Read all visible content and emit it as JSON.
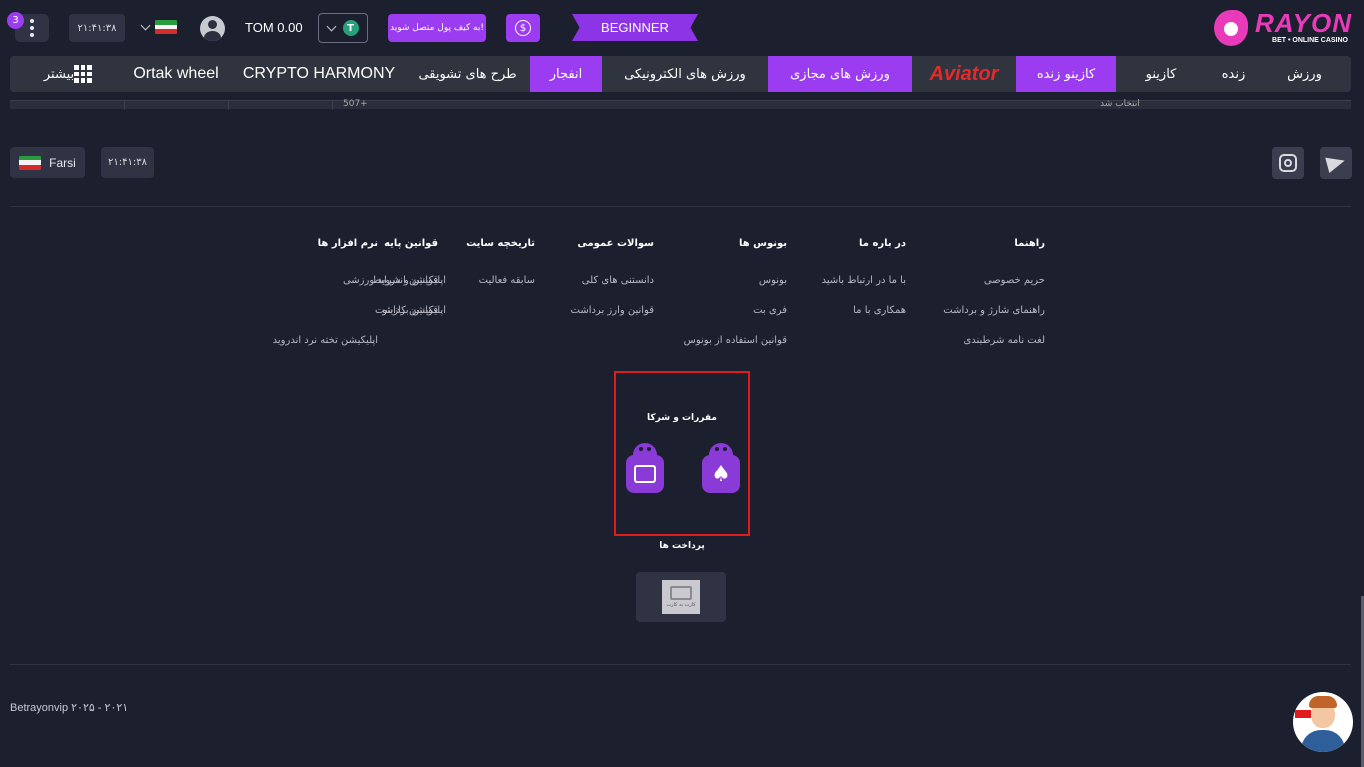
{
  "header": {
    "notification_count": "3",
    "time": "۲۱:۴۱:۳۸",
    "balance": "TOM 0.00",
    "currency_symbol": "T",
    "promo_label": "به کیف پول متصل شوید!",
    "dollar_symbol": "$",
    "level_label": "BEGINNER",
    "logo_text": "RAYON",
    "logo_sub": "BET • ONLINE CASINO"
  },
  "nav": {
    "items": [
      {
        "label": "ورزش",
        "active": false
      },
      {
        "label": "زنده",
        "active": false
      },
      {
        "label": "کازینو",
        "active": false
      },
      {
        "label": "کازینو زنده",
        "active": true
      },
      {
        "label": "Aviator",
        "active": false
      },
      {
        "label": "ورزش های مجازی",
        "active": true
      },
      {
        "label": "ورزش های الکترونیکی",
        "active": false
      },
      {
        "label": "انفجار",
        "active": true
      },
      {
        "label": "طرح های تشویقی",
        "active": false
      },
      {
        "label": "CRYPTO HARMONY",
        "active": false
      },
      {
        "label": "Ortak wheel",
        "active": false
      }
    ],
    "more_label": "بیشتر"
  },
  "strip": {
    "count_text": "507+",
    "side_text": "انتخاب شد"
  },
  "footer_top": {
    "language": "Farsi",
    "time": "۲۱:۴۱:۳۸"
  },
  "footer_columns": [
    {
      "title": "راهنما",
      "links": [
        "حریم خصوصی",
        "راهنمای شارژ و برداشت",
        "لغت نامه شرطبندی"
      ]
    },
    {
      "title": "در باره ما",
      "links": [
        "با ما در ارتباط باشید",
        "همکاری با ما"
      ]
    },
    {
      "title": "بونوس ها",
      "links": [
        "بونوس",
        "فری بت",
        "قوانین استفاده از بونوس"
      ]
    },
    {
      "title": "سوالات عمومی",
      "links": [
        "دانستنی های کلی",
        "قوانین وارز برداشت"
      ]
    },
    {
      "title": "تاریخچه سایت",
      "links": [
        "سابقه فعالیت"
      ]
    },
    {
      "title": "قوانین پایه",
      "links": [
        "قوانین و شرایط",
        "قوانین برداشت"
      ]
    },
    {
      "title": "نرم افزار ها",
      "links": [
        "اپلیکیشن اندروید ورزشی",
        "اپلیکیشن کازینو",
        "اپلیکیشن تخته نرد اندروید"
      ]
    }
  ],
  "partners": {
    "title": "مقررات و شرکا"
  },
  "payments": {
    "title": "پرداخت ها",
    "card_label": "کارت به کارت"
  },
  "copyright": "Betrayonvip ۲۰۲۵ - ۲۰۲۱",
  "colors": {
    "accent": "#9b3cf0",
    "background": "#1b1f2e",
    "nav_bg": "#30343f",
    "highlight_border": "#e01b1b"
  }
}
